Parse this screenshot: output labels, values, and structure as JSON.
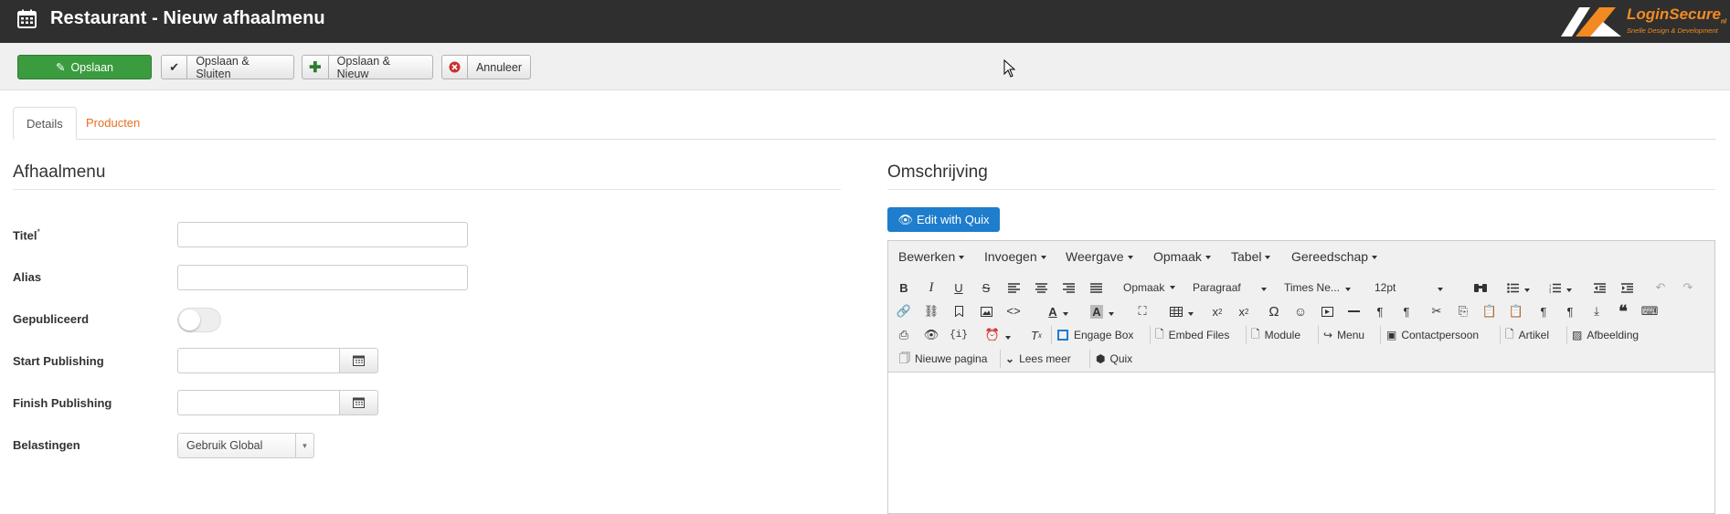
{
  "header": {
    "title": "Restaurant - Nieuw afhaalmenu",
    "logo_brand": "LoginSecure",
    "logo_sub": "nl",
    "logo_tagline": "Snelle Design & Development",
    "bg_color": "#2f2f2f",
    "accent_color": "#f28a22"
  },
  "toolbar": {
    "save_label": "Opslaan",
    "save_close_label": "Opslaan & Sluiten",
    "save_new_label": "Opslaan & Nieuw",
    "cancel_label": "Annuleer",
    "save_color": "#3b9c3f"
  },
  "tabs": {
    "details": "Details",
    "products": "Producten"
  },
  "left": {
    "section_title": "Afhaalmenu",
    "fields": {
      "title_label": "Titel",
      "title_required": "*",
      "alias_label": "Alias",
      "published_label": "Gepubliceerd",
      "start_label": "Start Publishing",
      "finish_label": "Finish Publishing",
      "tax_label": "Belastingen",
      "tax_value": "Gebruik Global"
    }
  },
  "right": {
    "section_title": "Omschrijving",
    "quix_label": "Edit with Quix",
    "menus": [
      "Bewerken",
      "Invoegen",
      "Weergave",
      "Opmaak",
      "Tabel",
      "Gereedschap"
    ],
    "format_select": "Opmaak",
    "paragraph_select": "Paragraaf",
    "font_select": "Times Ne...",
    "size_select": "12pt",
    "row3": {
      "engage_box": "Engage Box",
      "embed_files": "Embed Files",
      "module": "Module",
      "menu": "Menu",
      "contact": "Contactpersoon",
      "article": "Artikel",
      "image": "Afbeelding"
    },
    "row4": {
      "new_page": "Nieuwe pagina",
      "read_more": "Lees meer",
      "quix": "Quix"
    }
  }
}
